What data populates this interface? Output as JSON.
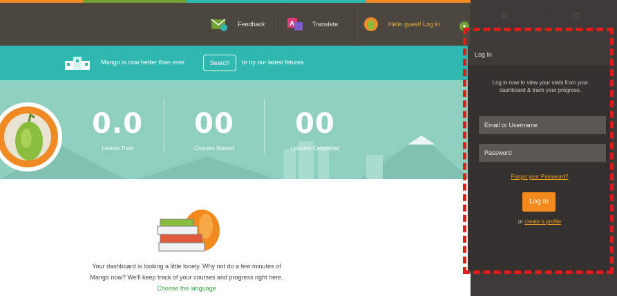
{
  "colors": {
    "topbar": "#4c4640",
    "banner": "#2eb8b0",
    "stats_bg": "#8fcfbf",
    "accent_orange": "#f28a1e",
    "link_green": "#3aa040",
    "highlight_red": "#e31b1b"
  },
  "topbar": {
    "feedback_label": "Feedback",
    "translate_label": "Translate",
    "user_label": "Hello guest! Log In"
  },
  "banner": {
    "text_before": "Mango is now better than ever.",
    "button_label": "Search",
    "text_after": "to try our latest fetures."
  },
  "stats": [
    {
      "value": "0.0",
      "label": "Lesson Time"
    },
    {
      "value": "00",
      "label": "Courses Started"
    },
    {
      "value": "00",
      "label": "Lessons Completed"
    }
  ],
  "main": {
    "message": "Your dashboard is looking a little lonely. Why not do a few minutes of Mango now? We'll keep track of your courses and progress right here.",
    "link": "Choose the language"
  },
  "login_panel": {
    "title": "Log In",
    "description": "Log in now to view your stats from your dashboard & track your progress.",
    "email_placeholder": "Email or Username",
    "password_placeholder": "Password",
    "forgot_link": "Forgot your Password?",
    "login_button": "Log In",
    "create_prefix": "or",
    "create_link": "create a profile"
  },
  "icons": [
    "feedback-icon",
    "translate-icon",
    "mango-avatar-icon",
    "chevron-down-icon",
    "settings-icon",
    "more-icon",
    "power-icon",
    "school-building-icon",
    "books-mango-icon"
  ]
}
